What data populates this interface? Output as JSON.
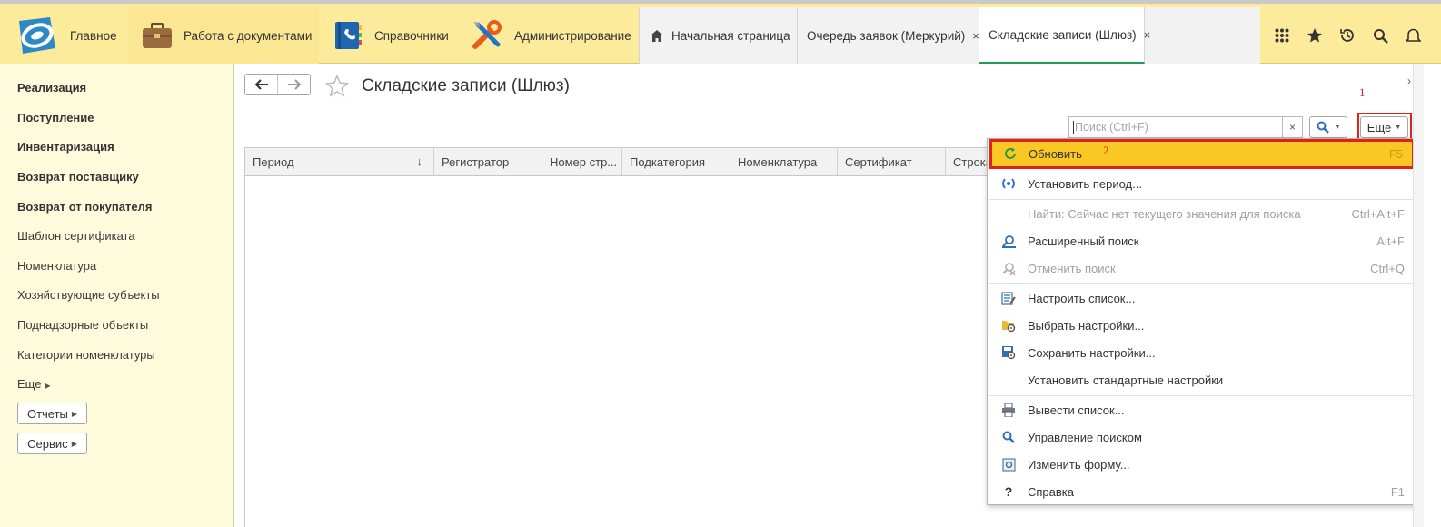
{
  "topbar": {
    "sections": [
      {
        "label": "Главное",
        "icon": "logo-icon"
      },
      {
        "label": "Работа с документами",
        "icon": "briefcase-icon"
      },
      {
        "label": "Справочники",
        "icon": "phonebook-icon"
      },
      {
        "label": "Администрирование",
        "icon": "tools-icon"
      }
    ],
    "tabs": [
      {
        "label": "Начальная страница",
        "icon": "home-icon"
      },
      {
        "label": "Очередь заявок (Меркурий)",
        "close": "×"
      },
      {
        "label": "Складские записи (Шлюз)",
        "close": "×"
      }
    ]
  },
  "sidebar": {
    "items_bold": [
      "Реализация",
      "Поступление",
      "Инвентаризация",
      "Возврат поставщику",
      "Возврат от покупателя"
    ],
    "items": [
      "Шаблон сертификата",
      "Номенклатура",
      "Хозяйствующие субъекты",
      "Поднадзорные объекты",
      "Категории номенклатуры"
    ],
    "more": "Еще",
    "buttons": [
      "Отчеты",
      "Сервис"
    ]
  },
  "page": {
    "title": "Складские записи (Шлюз)",
    "search_placeholder": "Поиск (Ctrl+F)",
    "search_clear": "×",
    "more_button": "Еще"
  },
  "table": {
    "columns": [
      "Период",
      "Регистратор",
      "Номер стр...",
      "Подкатегория",
      "Номенклатура",
      "Сертификат",
      "Строка"
    ],
    "sort_indicator": "↓"
  },
  "menu": {
    "items": [
      {
        "label": "Обновить",
        "key": "F5",
        "icon": "refresh-icon",
        "highlighted": true
      },
      {
        "label": "Установить период...",
        "key": "",
        "icon": "period-icon"
      },
      {
        "label": "Найти: Сейчас нет текущего значения для поиска",
        "key": "Ctrl+Alt+F",
        "icon": "",
        "disabled": true
      },
      {
        "label": "Расширенный поиск",
        "key": "Alt+F",
        "icon": "advanced-search-icon"
      },
      {
        "label": "Отменить поиск",
        "key": "Ctrl+Q",
        "icon": "cancel-search-icon",
        "disabled": true
      },
      {
        "label": "Настроить список...",
        "key": "",
        "icon": "configure-list-icon"
      },
      {
        "label": "Выбрать настройки...",
        "key": "",
        "icon": "choose-settings-icon"
      },
      {
        "label": "Сохранить настройки...",
        "key": "",
        "icon": "save-settings-icon"
      },
      {
        "label": "Установить стандартные настройки",
        "key": "",
        "icon": ""
      },
      {
        "label": "Вывести список...",
        "key": "",
        "icon": "print-list-icon"
      },
      {
        "label": "Управление поиском",
        "key": "",
        "icon": "search-manage-icon"
      },
      {
        "label": "Изменить форму...",
        "key": "",
        "icon": "edit-form-icon"
      },
      {
        "label": "Справка",
        "key": "F1",
        "icon": "help-icon"
      }
    ]
  },
  "annotations": {
    "step1": "1",
    "step2": "2"
  },
  "colors": {
    "accent_yellow": "#fbeb9a",
    "highlight": "#f9c825",
    "annotation_red": "#e0201b",
    "active_tab_line": "#1a9e5a"
  }
}
